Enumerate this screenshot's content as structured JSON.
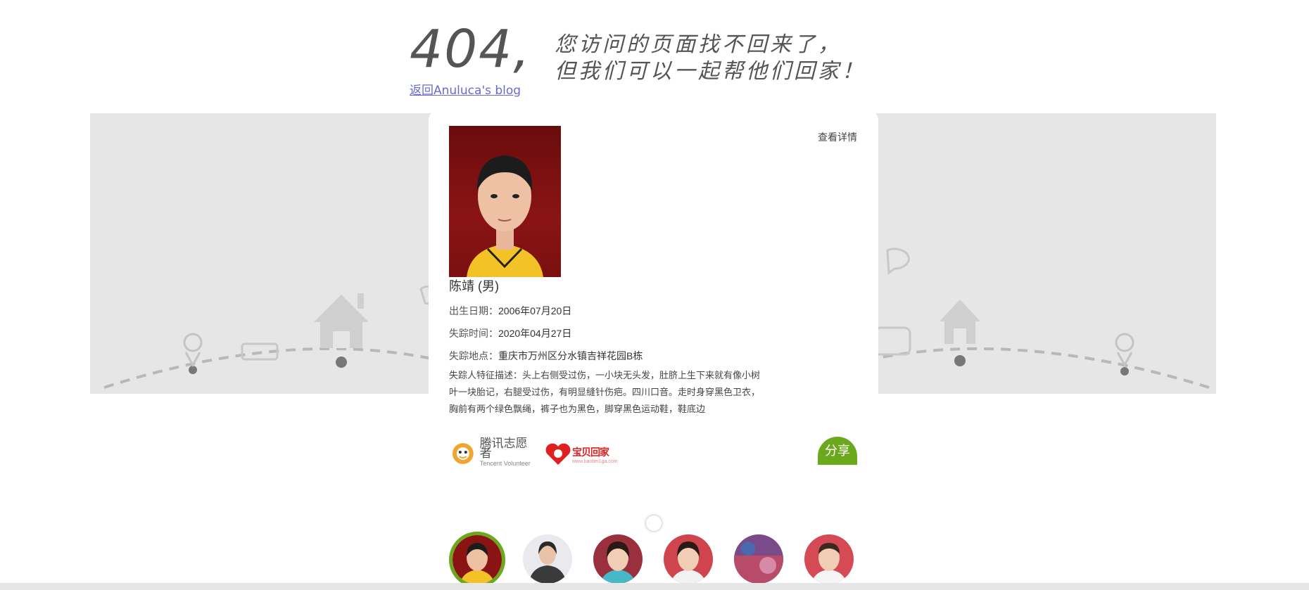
{
  "heading": {
    "code": "404,",
    "line1": "您访问的页面找不回来了，",
    "line2": "但我们可以一起帮他们回家！"
  },
  "back_link": "返回Anuluca's blog",
  "card": {
    "details_link": "查看详情",
    "name": "陈靖 (男)",
    "birth_label": "出生日期：",
    "birth_value": "2006年07月20日",
    "missing_time_label": "失踪时间：",
    "missing_time_value": "2020年04月27日",
    "missing_place_label": "失踪地点：",
    "missing_place_value": "重庆市万州区分水镇吉祥花园B栋",
    "description_label": "失踪人特征描述：",
    "description_value": "头上右侧受过伤，一小块无头发，肚脐上生下来就有像小树叶一块胎记，右腿受过伤，有明显缝针伤疤。四川口音。走时身穿黑色卫衣，胸前有两个绿色飘绳，裤子也为黑色，脚穿黑色运动鞋，鞋底边",
    "share_button": "分享"
  },
  "logos": {
    "tencent_cn": "腾讯志愿者",
    "tencent_en": "Tencent Volunteer",
    "baobei_cn": "宝贝回家",
    "baobei_url": "www.baobei1ga.com"
  },
  "thumbnails": [
    {
      "name": "thumb-1",
      "active": true
    },
    {
      "name": "thumb-2",
      "active": false
    },
    {
      "name": "thumb-3",
      "active": false
    },
    {
      "name": "thumb-4",
      "active": false
    },
    {
      "name": "thumb-5",
      "active": false
    },
    {
      "name": "thumb-6",
      "active": false
    }
  ],
  "colors": {
    "accent": "#6aa81c",
    "link": "#6a6ad2",
    "banner_bg": "#e6e6e6"
  }
}
